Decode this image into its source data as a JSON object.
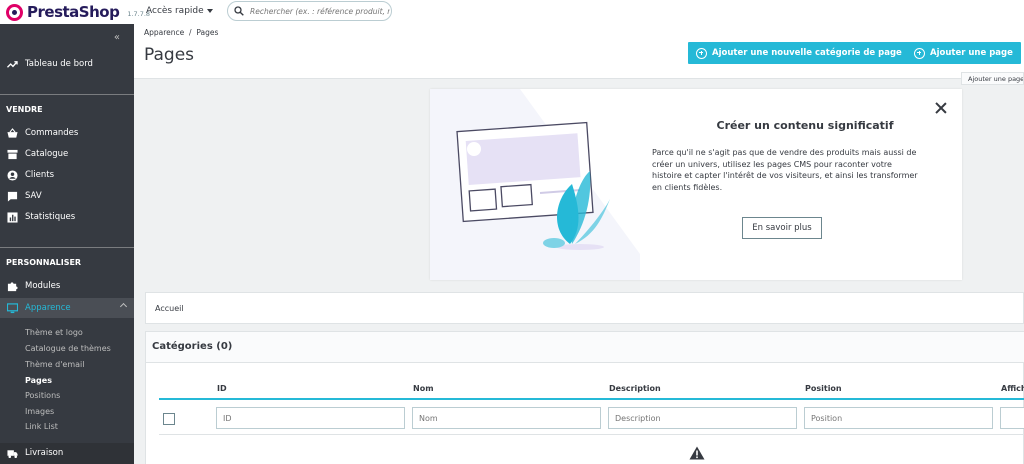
{
  "brand": {
    "name": "PrestaShop",
    "version": "1.7.7.8"
  },
  "topbar": {
    "quick_access": "Accès rapide",
    "search_placeholder": "Rechercher (ex. : référence produit, nom"
  },
  "sidebar": {
    "dashboard": "Tableau de bord",
    "section_sell": "VENDRE",
    "sell_items": [
      "Commandes",
      "Catalogue",
      "Clients",
      "SAV",
      "Statistiques"
    ],
    "section_customize": "PERSONNALISER",
    "modules": "Modules",
    "appearance": "Apparence",
    "appearance_sub": [
      "Thème et logo",
      "Catalogue de thèmes",
      "Thème d'email",
      "Pages",
      "Positions",
      "Images",
      "Link List"
    ],
    "shipping": "Livraison"
  },
  "header": {
    "breadcrumb": "Apparence  /  Pages",
    "title": "Pages",
    "add_category_button": "Ajouter une nouvelle catégorie de page",
    "add_page_button": "Ajouter une page",
    "tooltip": "Ajouter une page"
  },
  "onboarding": {
    "title": "Créer un contenu significatif",
    "text": "Parce qu'il ne s'agit pas que de vendre des produits mais aussi de créer un univers, utilisez les pages CMS pour raconter votre histoire et capter l'intérêt de vos visiteurs, et ainsi les transformer en clients fidèles.",
    "button": "En savoir plus"
  },
  "breadcrumb_panel": {
    "label": "Accueil"
  },
  "categories": {
    "title": "Catégories (0)",
    "columns": [
      "ID",
      "Nom",
      "Description",
      "Position",
      "Affich"
    ],
    "filters": [
      "ID",
      "Nom",
      "Description",
      "Position"
    ]
  },
  "colors": {
    "accent": "#25b9d7",
    "sidebar": "#363a41",
    "brand": "#df0067"
  }
}
